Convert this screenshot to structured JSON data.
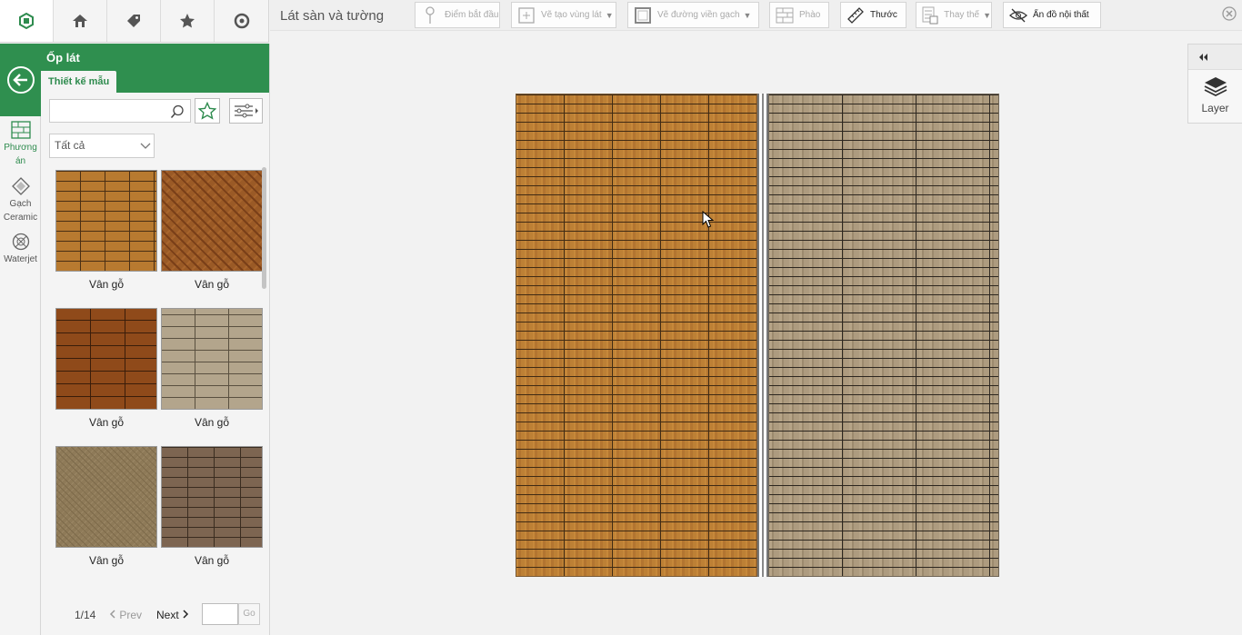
{
  "topnav": {
    "tabs": [
      {
        "icon": "app-logo-icon"
      },
      {
        "icon": "house-icon"
      },
      {
        "icon": "tag-icon"
      },
      {
        "icon": "star-icon"
      },
      {
        "icon": "compass-icon"
      }
    ]
  },
  "toolbar": {
    "title": "Lát sàn và tường",
    "buttons": [
      {
        "label": "Điểm bắt đầu",
        "icon": "pin-icon"
      },
      {
        "label": "Vẽ tạo vùng lát",
        "icon": "add-region-icon"
      },
      {
        "label": "Vẽ đường viền gạch",
        "icon": "border-icon"
      },
      {
        "label": "Phào",
        "icon": "molding-icon"
      },
      {
        "label": "Thước",
        "icon": "ruler-icon"
      },
      {
        "label": "Thay thế",
        "icon": "replace-icon"
      },
      {
        "label": "Ẩn đồ nội thất",
        "icon": "eye-off-icon"
      }
    ],
    "close_icon": "close-icon"
  },
  "rail": {
    "items": [
      {
        "label_line1": "Phương",
        "label_line2": "án",
        "icon": "grid-icon"
      },
      {
        "label_line1": "Gạch",
        "label_line2": "Ceramic",
        "icon": "ceramic-tile-icon"
      },
      {
        "label_line1": "Waterjet",
        "label_line2": "",
        "icon": "waterjet-icon"
      }
    ]
  },
  "panel": {
    "heading": "Ốp lát",
    "subtab": "Thiết kế mẫu",
    "search": {
      "value": "",
      "placeholder": ""
    },
    "select": {
      "value": "Tất cả"
    },
    "items": [
      {
        "label": "Vân gỗ"
      },
      {
        "label": "Vân gỗ"
      },
      {
        "label": "Vân gỗ"
      },
      {
        "label": "Vân gỗ"
      },
      {
        "label": "Vân gỗ"
      },
      {
        "label": "Vân gỗ"
      }
    ],
    "pager": {
      "page": "1/14",
      "prev": "Prev",
      "next": "Next",
      "go": "Go",
      "input": ""
    }
  },
  "layer_panel": {
    "label": "Layer"
  }
}
